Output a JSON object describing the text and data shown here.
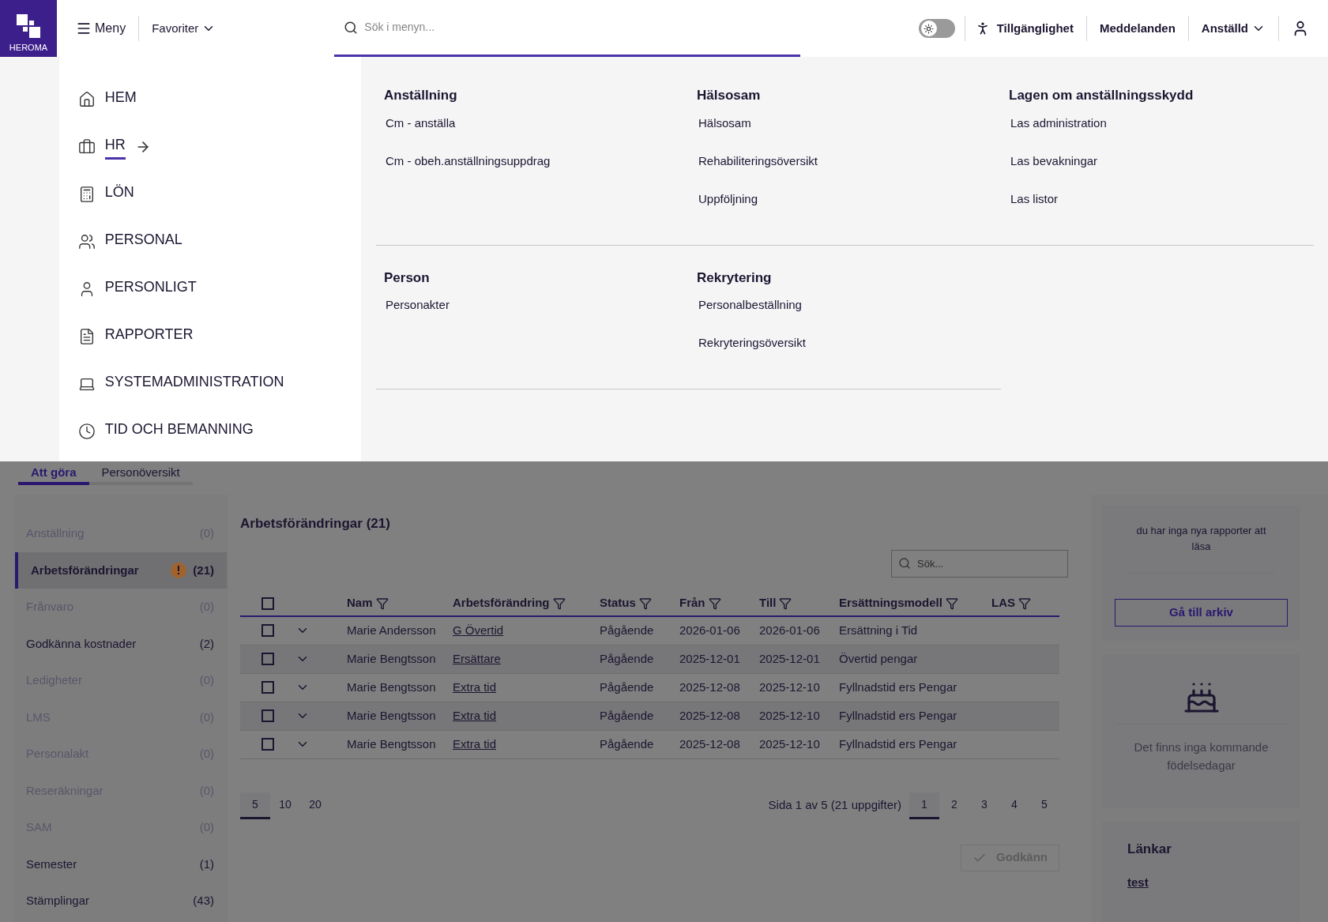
{
  "header": {
    "logo_text": "HEROMA",
    "menu_label": "Meny",
    "favorites_label": "Favoriter",
    "search": {
      "placeholder": "Sök i menyn..."
    },
    "theme_toggle": {
      "on": false
    },
    "accessibility_label": "Tillgänglighet",
    "messages_label": "Meddelanden",
    "role_label": "Anställd"
  },
  "mega_menu": {
    "categories": [
      {
        "label": "HEM",
        "selected": false
      },
      {
        "label": "HR",
        "selected": true
      },
      {
        "label": "LÖN",
        "selected": false
      },
      {
        "label": "PERSONAL",
        "selected": false
      },
      {
        "label": "PERSONLIGT",
        "selected": false
      },
      {
        "label": "RAPPORTER",
        "selected": false
      },
      {
        "label": "SYSTEMADMINISTRATION",
        "selected": false
      },
      {
        "label": "TID OCH BEMANNING",
        "selected": false
      }
    ],
    "sections": [
      [
        {
          "title": "Anställning",
          "links": [
            "Cm - anställa",
            "Cm - obeh.anställningsuppdrag"
          ]
        },
        {
          "title": "Hälsosam",
          "links": [
            "Hälsosam",
            "Rehabiliteringsöversikt",
            "Uppföljning"
          ]
        },
        {
          "title": "Lagen om anställningsskydd",
          "links": [
            "Las administration",
            "Las bevakningar",
            "Las listor"
          ]
        }
      ],
      [
        {
          "title": "Person",
          "links": [
            "Personakter"
          ]
        },
        {
          "title": "Rekrytering",
          "links": [
            "Personalbeställning",
            "Rekryteringsöversikt"
          ]
        }
      ]
    ]
  },
  "tabs": [
    {
      "label": "Att göra",
      "selected": true
    },
    {
      "label": "Personöversikt",
      "selected": false
    }
  ],
  "sidebar": {
    "items": [
      {
        "label": "Anställning",
        "count": "(0)",
        "disabled": true,
        "selected": false,
        "warning": false
      },
      {
        "label": "Arbetsförändringar",
        "count": "(21)",
        "disabled": false,
        "selected": true,
        "warning": true
      },
      {
        "label": "Frånvaro",
        "count": "(0)",
        "disabled": true,
        "selected": false,
        "warning": false
      },
      {
        "label": "Godkänna kostnader",
        "count": "(2)",
        "disabled": false,
        "selected": false,
        "warning": false
      },
      {
        "label": "Ledigheter",
        "count": "(0)",
        "disabled": true,
        "selected": false,
        "warning": false
      },
      {
        "label": "LMS",
        "count": "(0)",
        "disabled": true,
        "selected": false,
        "warning": false
      },
      {
        "label": "Personalakt",
        "count": "(0)",
        "disabled": true,
        "selected": false,
        "warning": false
      },
      {
        "label": "Reseräkningar",
        "count": "(0)",
        "disabled": true,
        "selected": false,
        "warning": false
      },
      {
        "label": "SAM",
        "count": "(0)",
        "disabled": true,
        "selected": false,
        "warning": false
      },
      {
        "label": "Semester",
        "count": "(1)",
        "disabled": false,
        "selected": false,
        "warning": false
      },
      {
        "label": "Stämplingar",
        "count": "(43)",
        "disabled": false,
        "selected": false,
        "warning": false
      }
    ]
  },
  "main": {
    "title": "Arbetsförändringar (21)",
    "search": {
      "placeholder": "Sök..."
    },
    "select_all": {
      "checked": false
    },
    "table": {
      "columns": [
        "Nam",
        "Arbetsförändring",
        "Status",
        "Från",
        "Till",
        "Ersättningsmodell",
        "LAS"
      ],
      "rows": [
        {
          "checked": false,
          "cells": [
            "Marie Andersson",
            "G Övertid",
            "Pågående",
            "2026-01-06",
            "2026-01-06",
            "Ersättning i Tid"
          ]
        },
        {
          "checked": false,
          "cells": [
            "Marie Bengtsson",
            "Ersättare",
            "Pågående",
            "2025-12-01",
            "2025-12-01",
            "Övertid pengar"
          ]
        },
        {
          "checked": false,
          "cells": [
            "Marie Bengtsson",
            "Extra tid",
            "Pågående",
            "2025-12-08",
            "2025-12-10",
            "Fyllnadstid ers Pengar"
          ]
        },
        {
          "checked": false,
          "cells": [
            "Marie Bengtsson",
            "Extra tid",
            "Pågående",
            "2025-12-08",
            "2025-12-10",
            "Fyllnadstid ers Pengar"
          ]
        },
        {
          "checked": false,
          "cells": [
            "Marie Bengtsson",
            "Extra tid",
            "Pågående",
            "2025-12-08",
            "2025-12-10",
            "Fyllnadstid ers Pengar"
          ]
        }
      ]
    },
    "page_sizes": [
      {
        "label": "5",
        "selected": true
      },
      {
        "label": "10",
        "selected": false
      },
      {
        "label": "20",
        "selected": false
      }
    ],
    "page_info": "Sida 1 av 5 (21 uppgifter)",
    "pages": [
      {
        "label": "1",
        "selected": true
      },
      {
        "label": "2",
        "selected": false
      },
      {
        "label": "3",
        "selected": false
      },
      {
        "label": "4",
        "selected": false
      },
      {
        "label": "5",
        "selected": false
      }
    ],
    "approve_button": {
      "label": "Godkänn",
      "disabled": true
    }
  },
  "cards": {
    "reports_text": "du har inga nya rapporter att läsa",
    "archive_button": "Gå till arkiv",
    "birthdays_text": "Det finns inga kommande födelsedagar",
    "links_title": "Länkar",
    "links": [
      "test"
    ]
  }
}
